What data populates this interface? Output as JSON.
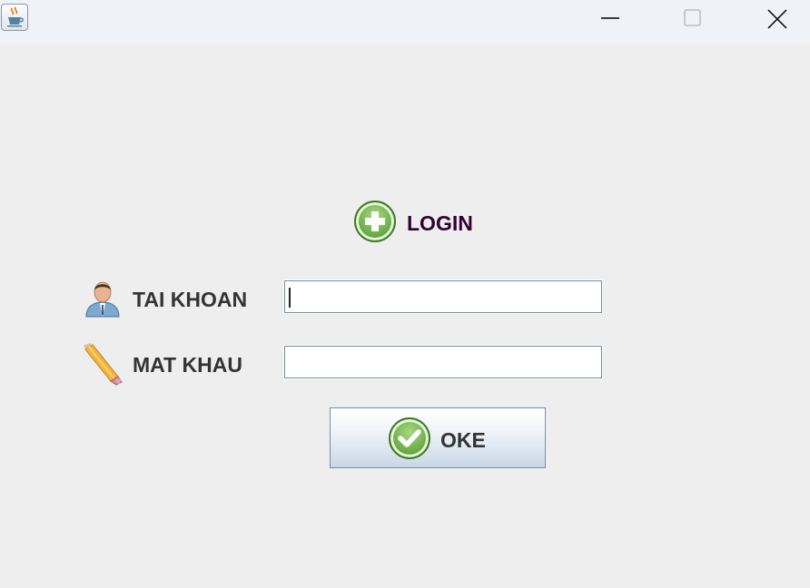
{
  "window": {
    "app_icon": "java-cup-icon",
    "controls": {
      "minimize": "minimize-icon",
      "maximize": "maximize-icon",
      "close": "close-icon"
    }
  },
  "form": {
    "title": "LOGIN",
    "title_icon": "plus-circle-icon",
    "title_color": "#330033",
    "fields": {
      "username": {
        "label": "TAI KHOAN",
        "icon": "user-icon",
        "value": ""
      },
      "password": {
        "label": "MAT KHAU",
        "icon": "pencil-icon",
        "value": ""
      }
    },
    "submit": {
      "label": "OKE",
      "icon": "check-circle-icon"
    }
  },
  "colors": {
    "background": "#eeeeee",
    "titlebar": "#eff3f8",
    "icon_green": "#6fb14a",
    "label_text": "#333333"
  }
}
